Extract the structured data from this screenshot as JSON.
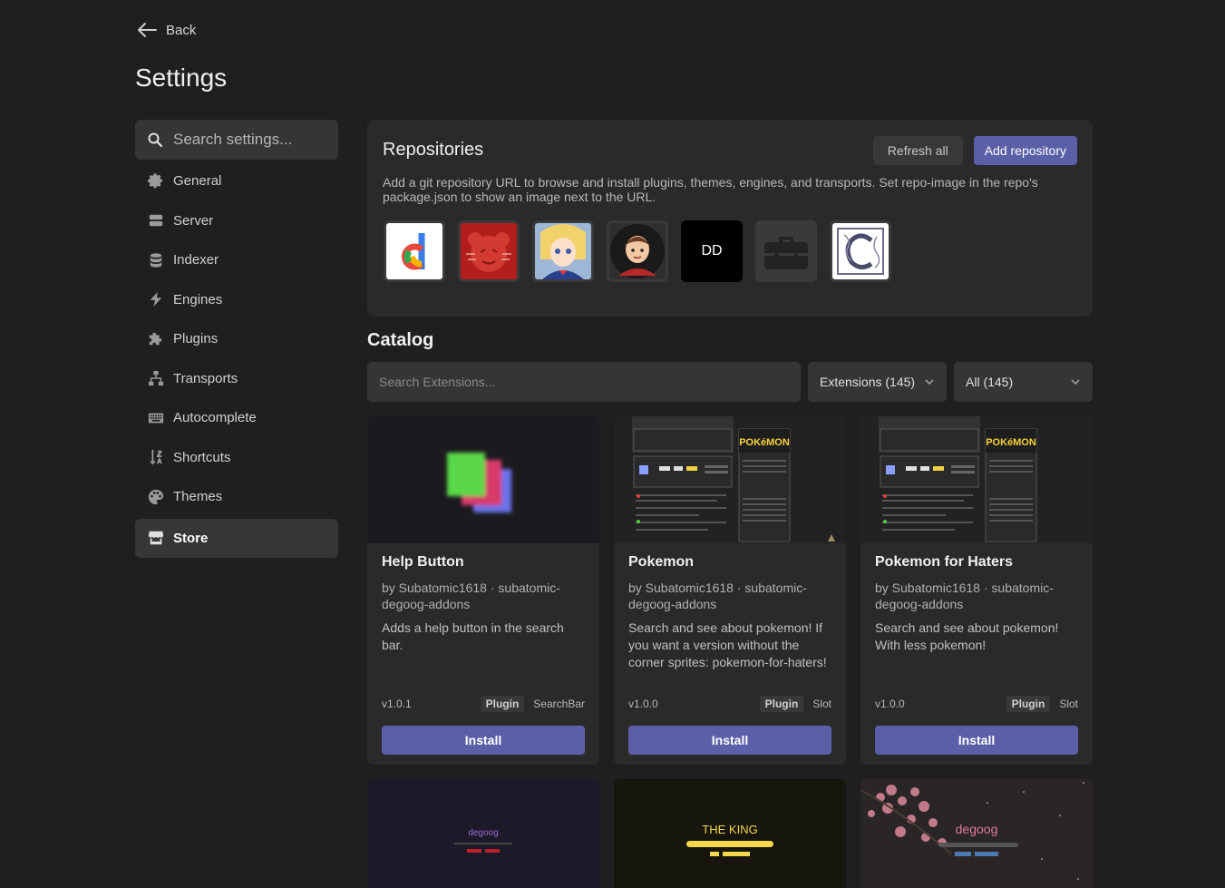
{
  "back_label": "Back",
  "page_title": "Settings",
  "sidebar": {
    "search_placeholder": "Search settings...",
    "items": [
      {
        "label": "General",
        "icon": "gear-icon"
      },
      {
        "label": "Server",
        "icon": "server-icon"
      },
      {
        "label": "Indexer",
        "icon": "database-icon"
      },
      {
        "label": "Engines",
        "icon": "bolt-icon"
      },
      {
        "label": "Plugins",
        "icon": "puzzle-icon"
      },
      {
        "label": "Transports",
        "icon": "network-icon"
      },
      {
        "label": "Autocomplete",
        "icon": "keyboard-icon"
      },
      {
        "label": "Shortcuts",
        "icon": "sort-icon"
      },
      {
        "label": "Themes",
        "icon": "palette-icon"
      },
      {
        "label": "Store",
        "icon": "store-icon",
        "active": true
      }
    ]
  },
  "repositories": {
    "title": "Repositories",
    "refresh_label": "Refresh all",
    "add_label": "Add repository",
    "description": "Add a git repository URL to browse and install plugins, themes, engines, and transports. Set repo-image in the repo's package.json to show an image next to the URL.",
    "icons": [
      "degoog-logo",
      "red-cat-avatar",
      "anime-girl-avatar",
      "character-avatar",
      "dd-logo",
      "toolbox-icon",
      "ornate-letter-icon"
    ],
    "dd_text": "DD"
  },
  "catalog": {
    "title": "Catalog",
    "search_placeholder": "Search Extensions...",
    "type_select": "Extensions (145)",
    "filter_select": "All (145)",
    "cards": [
      {
        "title": "Help Button",
        "author": "by Subatomic1618 · subatomic-degoog-addons",
        "description": "Adds a help button in the search bar.",
        "version": "v1.0.1",
        "tag": "Plugin",
        "slot": "SearchBar",
        "install": "Install"
      },
      {
        "title": "Pokemon",
        "author": "by Subatomic1618 · subatomic-degoog-addons",
        "description": "Search and see about pokemon! If you want a version without the corner sprites: pokemon-for-haters!",
        "version": "v1.0.0",
        "tag": "Plugin",
        "slot": "Slot",
        "install": "Install"
      },
      {
        "title": "Pokemon for Haters",
        "author": "by Subatomic1618 · subatomic-degoog-addons",
        "description": "Search and see about pokemon! With less pokemon!",
        "version": "v1.0.0",
        "tag": "Plugin",
        "slot": "Slot",
        "install": "Install"
      }
    ],
    "preview_texts": {
      "pokemon_logo": "POKéMON",
      "theme1_logo": "degoog",
      "theme2_title": "THE KING",
      "theme3_logo": "degoog"
    }
  }
}
